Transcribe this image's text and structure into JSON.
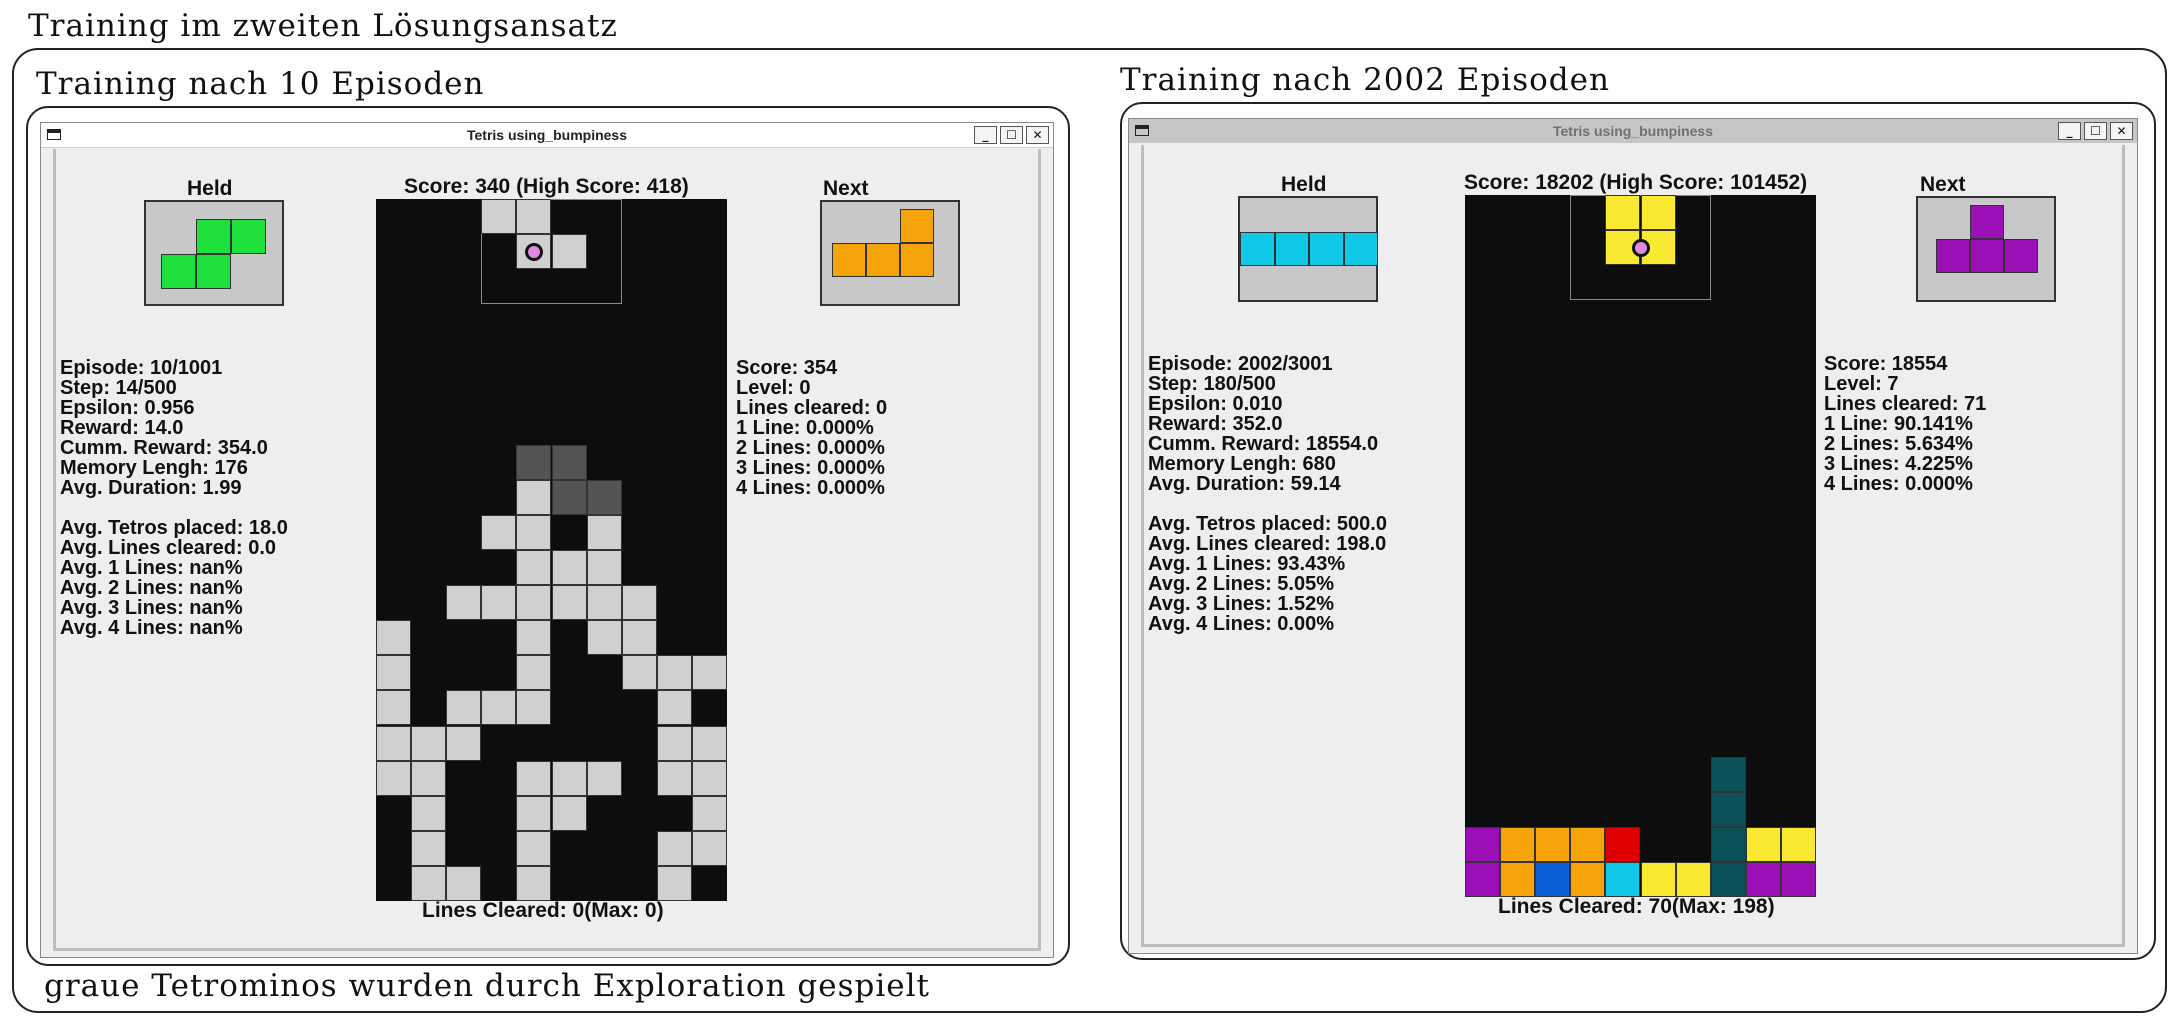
{
  "annotations": {
    "main_title": "Training im zweiten Lösungsansatz",
    "left_caption": "Training nach 10 Episoden",
    "right_caption": "Training nach 2002 Episoden",
    "footnote": "graue Tetrominos wurden durch Exploration gespielt"
  },
  "colors": {
    "green": "#1ee03c",
    "orange": "#f5a30a",
    "cyan": "#12c8e8",
    "purple": "#9a10b6",
    "yellow": "#f9e932",
    "red": "#e00000",
    "blue": "#0a5ed6",
    "teal": "#0b5158",
    "light_gray": "#d0d0d0",
    "dark_gray": "#545454",
    "board_bg": "#0d0d0d"
  },
  "left_window": {
    "title": "Tetris using_bumpiness",
    "title_state": "active",
    "buttons": [
      "_",
      "☐",
      "✕"
    ],
    "held_label": "Held",
    "next_label": "Next",
    "held_piece": "S",
    "next_piece": "L",
    "score_header": "Score: 340 (High Score: 418)",
    "lines_cleared_footer": "Lines Cleared: 0(Max: 0)",
    "stats_left": [
      "Episode: 10/1001",
      "Step: 14/500",
      "Epsilon: 0.956",
      "Reward: 14.0",
      "Cumm. Reward: 354.0",
      "Memory Lengh: 176",
      "Avg. Duration: 1.99"
    ],
    "stats_left2": [
      "Avg. Tetros placed: 18.0",
      "Avg. Lines cleared: 0.0",
      "Avg. 1 Lines: nan%",
      "Avg. 2 Lines: nan%",
      "Avg. 3 Lines: nan%",
      "Avg. 4 Lines: nan%"
    ],
    "stats_right": [
      "Score: 354",
      "Level: 0",
      "Lines cleared: 0",
      "1 Line: 0.000%",
      "2 Lines: 0.000%",
      "3 Lines: 0.000%",
      "4 Lines: 0.000%"
    ],
    "board": {
      "cols": 10,
      "rows": 20,
      "active_piece": {
        "color": "light_gray",
        "cells": [
          [
            3,
            0
          ],
          [
            4,
            0
          ],
          [
            4,
            1
          ],
          [
            5,
            1
          ]
        ],
        "pivot": [
          4,
          1
        ]
      },
      "cells": [
        {
          "c": 4,
          "r": 7,
          "color": "dark_gray"
        },
        {
          "c": 5,
          "r": 7,
          "color": "dark_gray"
        },
        {
          "c": 5,
          "r": 8,
          "color": "dark_gray"
        },
        {
          "c": 6,
          "r": 8,
          "color": "dark_gray"
        },
        {
          "c": 4,
          "r": 8,
          "color": "light_gray"
        },
        {
          "c": 3,
          "r": 9,
          "color": "light_gray"
        },
        {
          "c": 4,
          "r": 9,
          "color": "light_gray"
        },
        {
          "c": 6,
          "r": 9,
          "color": "light_gray"
        },
        {
          "c": 4,
          "r": 10,
          "color": "light_gray"
        },
        {
          "c": 5,
          "r": 10,
          "color": "light_gray"
        },
        {
          "c": 6,
          "r": 10,
          "color": "light_gray"
        },
        {
          "c": 2,
          "r": 11,
          "color": "light_gray"
        },
        {
          "c": 3,
          "r": 11,
          "color": "light_gray"
        },
        {
          "c": 4,
          "r": 11,
          "color": "light_gray"
        },
        {
          "c": 5,
          "r": 11,
          "color": "light_gray"
        },
        {
          "c": 6,
          "r": 11,
          "color": "light_gray"
        },
        {
          "c": 7,
          "r": 11,
          "color": "light_gray"
        },
        {
          "c": 0,
          "r": 12,
          "color": "light_gray"
        },
        {
          "c": 4,
          "r": 12,
          "color": "light_gray"
        },
        {
          "c": 6,
          "r": 12,
          "color": "light_gray"
        },
        {
          "c": 7,
          "r": 12,
          "color": "light_gray"
        },
        {
          "c": 0,
          "r": 13,
          "color": "light_gray"
        },
        {
          "c": 4,
          "r": 13,
          "color": "light_gray"
        },
        {
          "c": 7,
          "r": 13,
          "color": "light_gray"
        },
        {
          "c": 8,
          "r": 13,
          "color": "light_gray"
        },
        {
          "c": 9,
          "r": 13,
          "color": "light_gray"
        },
        {
          "c": 0,
          "r": 14,
          "color": "light_gray"
        },
        {
          "c": 2,
          "r": 14,
          "color": "light_gray"
        },
        {
          "c": 3,
          "r": 14,
          "color": "light_gray"
        },
        {
          "c": 4,
          "r": 14,
          "color": "light_gray"
        },
        {
          "c": 8,
          "r": 14,
          "color": "light_gray"
        },
        {
          "c": 0,
          "r": 15,
          "color": "light_gray"
        },
        {
          "c": 1,
          "r": 15,
          "color": "light_gray"
        },
        {
          "c": 2,
          "r": 15,
          "color": "light_gray"
        },
        {
          "c": 8,
          "r": 15,
          "color": "light_gray"
        },
        {
          "c": 9,
          "r": 15,
          "color": "light_gray"
        },
        {
          "c": 0,
          "r": 16,
          "color": "light_gray"
        },
        {
          "c": 1,
          "r": 16,
          "color": "light_gray"
        },
        {
          "c": 4,
          "r": 16,
          "color": "light_gray"
        },
        {
          "c": 5,
          "r": 16,
          "color": "light_gray"
        },
        {
          "c": 6,
          "r": 16,
          "color": "light_gray"
        },
        {
          "c": 8,
          "r": 16,
          "color": "light_gray"
        },
        {
          "c": 9,
          "r": 16,
          "color": "light_gray"
        },
        {
          "c": 1,
          "r": 17,
          "color": "light_gray"
        },
        {
          "c": 4,
          "r": 17,
          "color": "light_gray"
        },
        {
          "c": 5,
          "r": 17,
          "color": "light_gray"
        },
        {
          "c": 9,
          "r": 17,
          "color": "light_gray"
        },
        {
          "c": 1,
          "r": 18,
          "color": "light_gray"
        },
        {
          "c": 4,
          "r": 18,
          "color": "light_gray"
        },
        {
          "c": 8,
          "r": 18,
          "color": "light_gray"
        },
        {
          "c": 9,
          "r": 18,
          "color": "light_gray"
        },
        {
          "c": 1,
          "r": 19,
          "color": "light_gray"
        },
        {
          "c": 2,
          "r": 19,
          "color": "light_gray"
        },
        {
          "c": 4,
          "r": 19,
          "color": "light_gray"
        },
        {
          "c": 8,
          "r": 19,
          "color": "light_gray"
        }
      ]
    }
  },
  "right_window": {
    "title": "Tetris using_bumpiness",
    "title_state": "inactive",
    "buttons": [
      "_",
      "☐",
      "✕"
    ],
    "held_label": "Held",
    "next_label": "Next",
    "held_piece": "I",
    "next_piece": "T",
    "score_header": "Score: 18202 (High Score: 101452)",
    "lines_cleared_footer": "Lines Cleared: 70(Max: 198)",
    "stats_left": [
      "Episode: 2002/3001",
      "Step: 180/500",
      "Epsilon: 0.010",
      "Reward: 352.0",
      "Cumm. Reward: 18554.0",
      "Memory Lengh: 680",
      "Avg. Duration: 59.14"
    ],
    "stats_left2": [
      "Avg. Tetros placed: 500.0",
      "Avg. Lines cleared: 198.0",
      "Avg. 1 Lines: 93.43%",
      "Avg. 2 Lines: 5.05%",
      "Avg. 3 Lines: 1.52%",
      "Avg. 4 Lines: 0.00%"
    ],
    "stats_right": [
      "Score: 18554",
      "Level: 7",
      "Lines cleared: 71",
      "1 Line: 90.141%",
      "2 Lines: 5.634%",
      "3 Lines: 4.225%",
      "4 Lines: 0.000%"
    ],
    "board": {
      "cols": 10,
      "rows": 20,
      "active_piece": {
        "color": "yellow",
        "cells": [
          [
            4,
            0
          ],
          [
            5,
            0
          ],
          [
            4,
            1
          ],
          [
            5,
            1
          ]
        ],
        "pivot": [
          5,
          1
        ]
      },
      "cells": [
        {
          "c": 7,
          "r": 16,
          "color": "teal"
        },
        {
          "c": 7,
          "r": 17,
          "color": "teal"
        },
        {
          "c": 0,
          "r": 18,
          "color": "purple"
        },
        {
          "c": 1,
          "r": 18,
          "color": "orange"
        },
        {
          "c": 2,
          "r": 18,
          "color": "orange"
        },
        {
          "c": 3,
          "r": 18,
          "color": "orange"
        },
        {
          "c": 4,
          "r": 18,
          "color": "red"
        },
        {
          "c": 7,
          "r": 18,
          "color": "teal"
        },
        {
          "c": 8,
          "r": 18,
          "color": "yellow"
        },
        {
          "c": 9,
          "r": 18,
          "color": "yellow"
        },
        {
          "c": 0,
          "r": 19,
          "color": "purple"
        },
        {
          "c": 1,
          "r": 19,
          "color": "orange"
        },
        {
          "c": 2,
          "r": 19,
          "color": "blue"
        },
        {
          "c": 3,
          "r": 19,
          "color": "orange"
        },
        {
          "c": 4,
          "r": 19,
          "color": "cyan"
        },
        {
          "c": 5,
          "r": 19,
          "color": "yellow"
        },
        {
          "c": 6,
          "r": 19,
          "color": "yellow"
        },
        {
          "c": 7,
          "r": 19,
          "color": "teal"
        },
        {
          "c": 8,
          "r": 19,
          "color": "purple"
        },
        {
          "c": 9,
          "r": 19,
          "color": "purple"
        }
      ]
    }
  }
}
